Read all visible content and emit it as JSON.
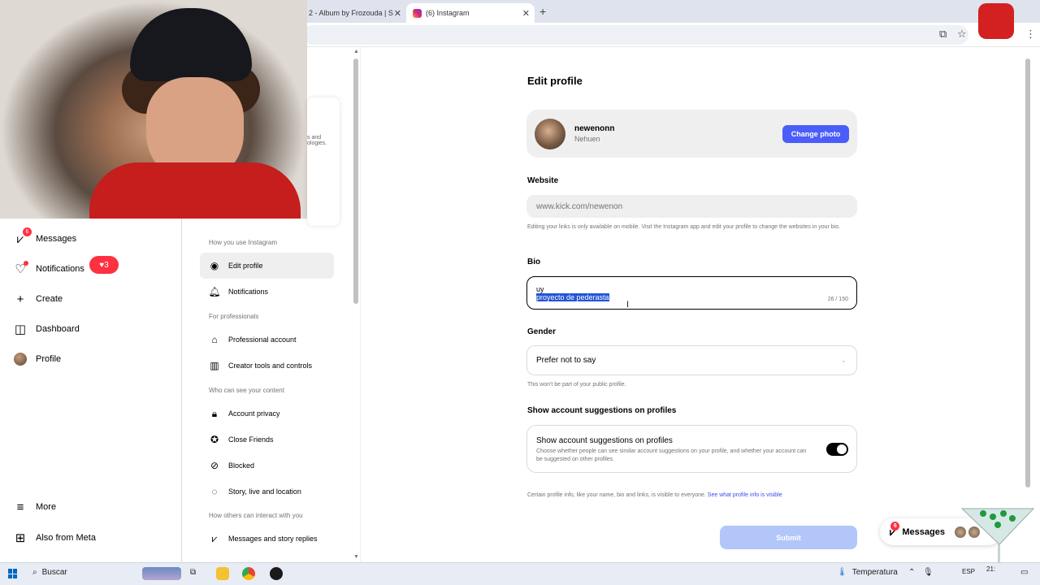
{
  "browser": {
    "tabs": [
      {
        "title": "2 - Album by Frozouda | S"
      },
      {
        "title": "(6) Instagram"
      }
    ],
    "new_tab": "+"
  },
  "left_nav": {
    "items": [
      {
        "label": "Messages",
        "icon": "messenger-icon",
        "badge": "6"
      },
      {
        "label": "Notifications",
        "icon": "heart-icon"
      },
      {
        "label": "Create",
        "icon": "plus-icon"
      },
      {
        "label": "Dashboard",
        "icon": "dashboard-icon"
      },
      {
        "label": "Profile",
        "icon": "avatar"
      }
    ],
    "notif_count": "3",
    "more": "More",
    "also_from_meta": "Also from Meta"
  },
  "settings_menu": {
    "meta_card_text": "s and ologies.",
    "sections": [
      {
        "heading": "How you use Instagram"
      },
      {
        "heading": "For professionals"
      },
      {
        "heading": "Who can see your content"
      },
      {
        "heading": "How others can interact with you"
      }
    ],
    "items": [
      {
        "label": "Edit profile",
        "icon": "user-circle-icon"
      },
      {
        "label": "Notifications",
        "icon": "bell-icon"
      },
      {
        "label": "Professional account",
        "icon": "store-icon"
      },
      {
        "label": "Creator tools and controls",
        "icon": "chart-icon"
      },
      {
        "label": "Account privacy",
        "icon": "lock-icon"
      },
      {
        "label": "Close Friends",
        "icon": "star-circle-icon"
      },
      {
        "label": "Blocked",
        "icon": "blocked-icon"
      },
      {
        "label": "Story, live and location",
        "icon": "story-icon"
      },
      {
        "label": "Messages and story replies",
        "icon": "messenger-icon"
      }
    ]
  },
  "edit_profile": {
    "title": "Edit profile",
    "username": "newenonn",
    "full_name": "Nehuen",
    "change_photo": "Change photo",
    "website_label": "Website",
    "website_placeholder": "www.kick.com/newenon",
    "website_note": "Editing your links is only available on mobile. Visit the Instagram app and edit your profile to change the websites in your bio.",
    "bio_label": "Bio",
    "bio_line1": "uy",
    "bio_line2": "proyecto de pederasta",
    "bio_count": "26 / 150",
    "gender_label": "Gender",
    "gender_value": "Prefer not to say",
    "gender_note": "This won't be part of your public profile.",
    "suggestions_label": "Show account suggestions on profiles",
    "suggestions_title": "Show account suggestions on profiles",
    "suggestions_desc": "Choose whether people can see similar account suggestions on your profile, and whether your account can be suggested on other profiles.",
    "suggestions_enabled": true,
    "footer_text": "Certain profile info, like your name, bio and links, is visible to everyone.",
    "footer_link": "See what profile info is visible",
    "submit": "Submit"
  },
  "messages_pill": {
    "label": "Messages",
    "badge": "6"
  },
  "taskbar": {
    "search": "Buscar",
    "weather": "Temperatura",
    "language": "ESP",
    "time": "21:"
  },
  "colors": {
    "accent": "#4a5df9",
    "submit_disabled": "#b2c6fa",
    "badge": "#ff3040",
    "selection": "#2355d6"
  }
}
